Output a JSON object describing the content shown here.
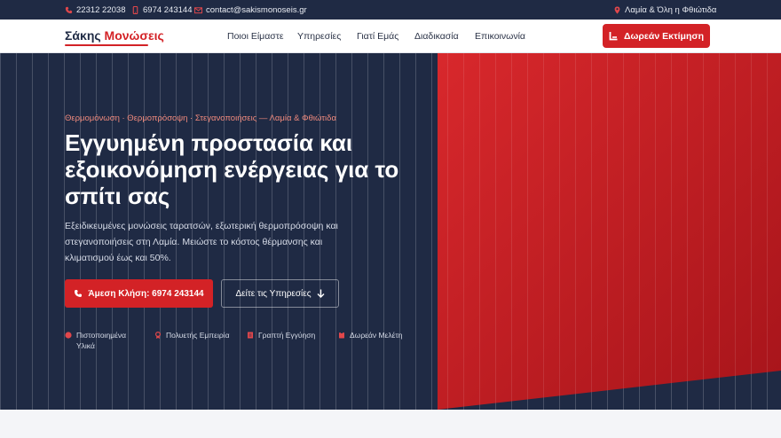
{
  "topbar": {
    "phone1": "22312 22038",
    "phone2": "6974 243144",
    "email": "contact@sakismonoseis.gr",
    "location": "Λαμία & Όλη η Φθιώτιδα"
  },
  "header": {
    "logo_name": "Σάκης",
    "logo_accent": "Μονώσεις",
    "nav": [
      "Ποιοι Είμαστε",
      "Υπηρεσίες",
      "Γιατί Εμάς",
      "Διαδικασία",
      "Επικοινωνία"
    ],
    "cta_label": "Δωρεάν Εκτίμηση"
  },
  "hero": {
    "eyebrow": "Θερμομόνωση · Θερμοπρόσοψη · Στεγανοποιήσεις — Λαμία & Φθιώτιδα",
    "title": "Εγγυημένη προστασία και εξοικονόμηση ενέργειας για το σπίτι σας",
    "subtitle": "Εξειδικευμένες μονώσεις ταρατσών, εξωτερική θερμοπρόσοψη και στεγανοποιήσεις στη Λαμία. Μειώστε το κόστος θέρμανσης και κλιματισμού έως και 50%.",
    "call_button": "Άμεση Κλήση: 6974 243144",
    "services_button": "Δείτε τις Υπηρεσίες",
    "features": [
      "Πιστοποιημένα Υλικά",
      "Πολυετής Εμπειρία",
      "Γραπτή Εγγύηση",
      "Δωρεάν Μελέτη"
    ]
  },
  "colors": {
    "navy": "#1f2a44",
    "red": "#d32226",
    "accent_text": "#f08a7d"
  }
}
